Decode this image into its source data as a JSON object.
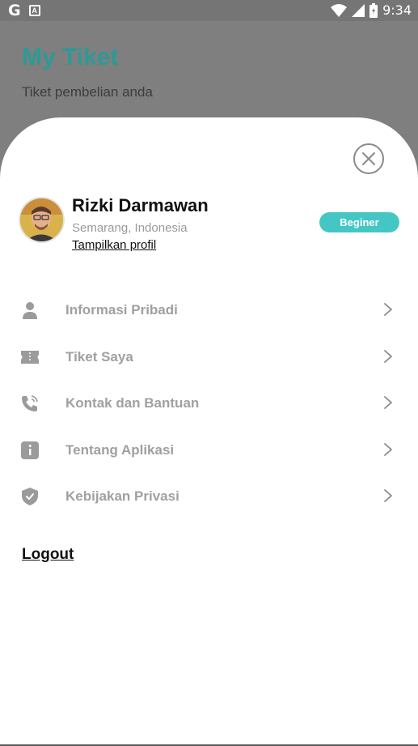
{
  "status_bar": {
    "google_letter": "G",
    "notification_letter": "A",
    "time": "9:34",
    "icons": [
      "google-icon",
      "notification-icon",
      "wifi-icon",
      "signal-icon",
      "battery-icon"
    ]
  },
  "background": {
    "title": "My Tiket",
    "subtitle": "Tiket pembelian anda",
    "title_color": "#2c9a95"
  },
  "profile": {
    "name": "Rizki Darmawan",
    "location": "Semarang, Indonesia",
    "profile_link": "Tampilkan profil",
    "badge": "Beginer",
    "badge_color": "#44c7c4"
  },
  "menu": {
    "items": [
      {
        "label": "Informasi Pribadi",
        "icon": "person-icon"
      },
      {
        "label": "Tiket Saya",
        "icon": "ticket-icon"
      },
      {
        "label": "Kontak dan Bantuan",
        "icon": "phone-icon"
      },
      {
        "label": "Tentang Aplikasi",
        "icon": "info-icon"
      },
      {
        "label": "Kebijakan Privasi",
        "icon": "shield-icon"
      }
    ]
  },
  "logout_label": "Logout"
}
